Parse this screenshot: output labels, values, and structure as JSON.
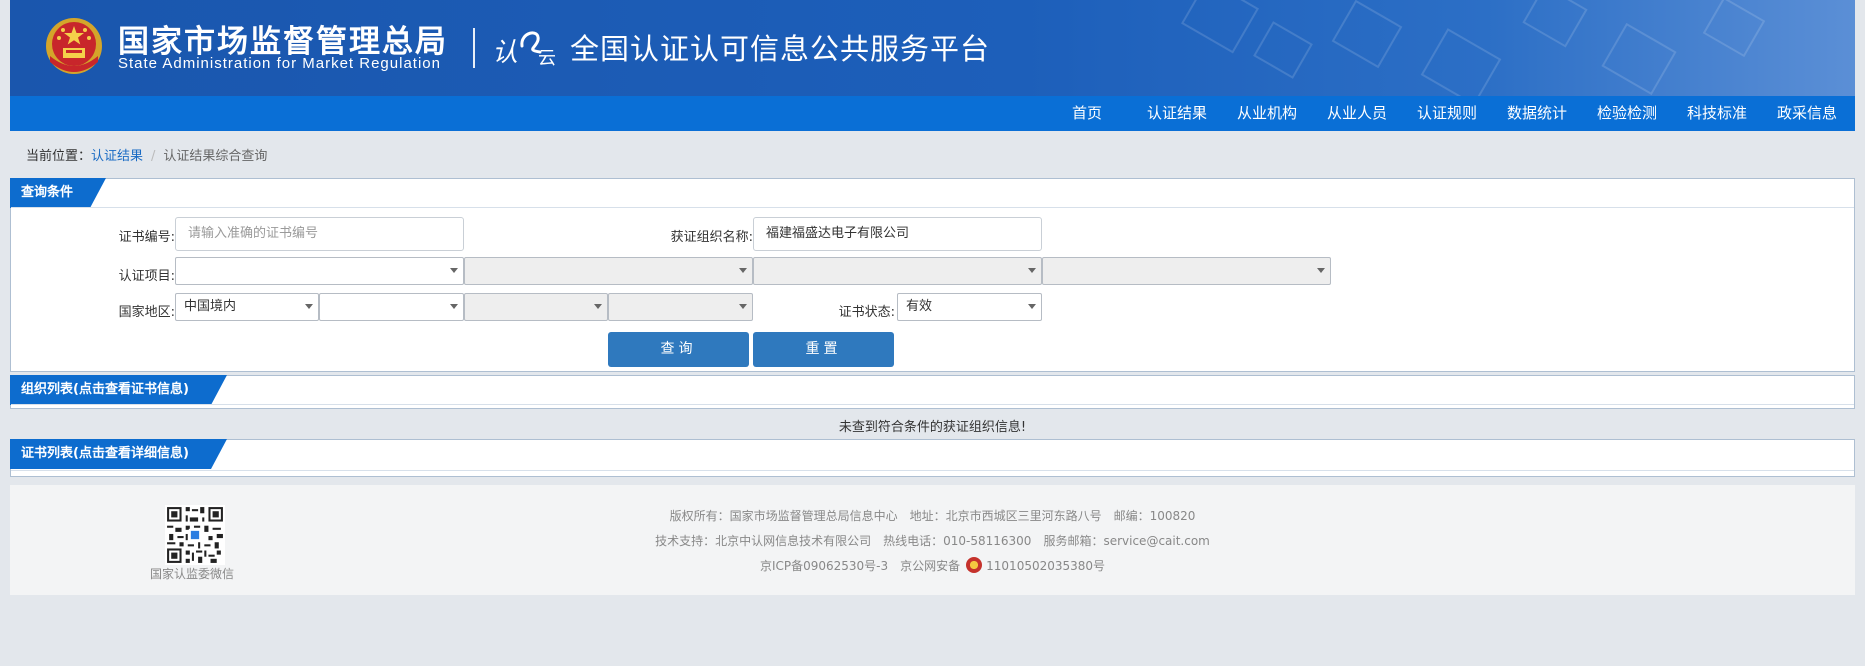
{
  "header": {
    "agency_cn": "国家市场监督管理总局",
    "agency_en": "State Administration  for  Market Regulation",
    "platform_title": "全国认证认可信息公共服务平台",
    "logo2_text_a": "认",
    "logo2_text_b": "云"
  },
  "nav": {
    "items": [
      "首页",
      "认证结果",
      "从业机构",
      "从业人员",
      "认证规则",
      "数据统计",
      "检验检测",
      "科技标准",
      "政采信息"
    ]
  },
  "breadcrumb": {
    "prefix": "当前位置：",
    "link": "认证结果",
    "separator": "/",
    "current": "认证结果综合查询"
  },
  "query_panel": {
    "title": "查询条件",
    "cert_no_label": "证书编号:",
    "cert_no_placeholder": "请输入准确的证书编号",
    "org_name_label": "获证组织名称:",
    "org_name_value": "福建福盛达电子有限公司",
    "project_label": "认证项目:",
    "region_label": "国家地区:",
    "region_value": "中国境内",
    "status_label": "证书状态:",
    "status_value": "有效",
    "search_button": "查询",
    "reset_button": "重置"
  },
  "org_panel": {
    "title": "组织列表(点击查看证书信息)",
    "empty_message": "未查到符合条件的获证组织信息!"
  },
  "cert_panel": {
    "title": "证书列表(点击查看详细信息)"
  },
  "footer": {
    "qr_caption": "国家认监委微信",
    "copyright": "版权所有：国家市场监督管理总局信息中心",
    "address": "地址：北京市西城区三里河东路八号",
    "postcode": "邮编：100820",
    "tech_support": "技术支持：北京中认网信息技术有限公司",
    "hotline": "热线电话：010-58116300",
    "email": "服务邮箱：service@cait.com",
    "icp": "京ICP备09062530号-3",
    "police_prefix": "京公网安备",
    "police_no": "11010502035380号"
  },
  "colors": {
    "banner": "#1d5fba",
    "nav": "#0a6fd6",
    "panel_tab": "#0d6cce",
    "button": "#2f79be"
  }
}
